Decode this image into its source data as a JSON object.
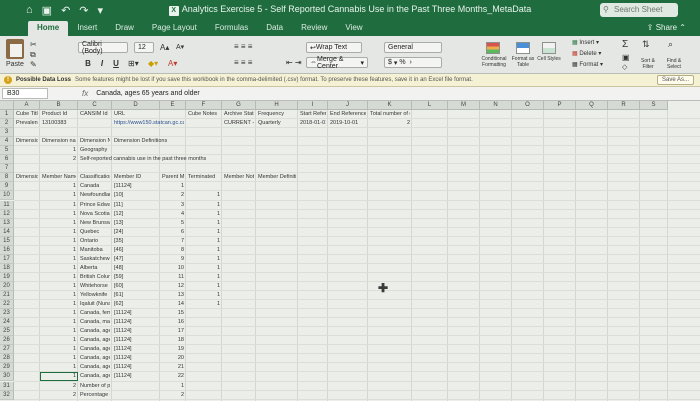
{
  "window": {
    "title": "Analytics Exercise 5 - Self Reported Cannabis Use in the Past Three Months_MetaData",
    "search_placeholder": "Search Sheet"
  },
  "tabs": [
    "Home",
    "Insert",
    "Draw",
    "Page Layout",
    "Formulas",
    "Data",
    "Review",
    "View"
  ],
  "share_label": "Share",
  "ribbon": {
    "paste": "Paste",
    "font_name": "Calibri (Body)",
    "font_size": "12",
    "wrap_text": "Wrap Text",
    "merge_center": "Merge & Center",
    "number_format": "General",
    "currency": "$",
    "percent": "%",
    "conditional_formatting": "Conditional Formatting",
    "format_as_table": "Format as Table",
    "cell_styles": "Cell Styles",
    "insert": "Insert",
    "delete": "Delete",
    "format": "Format",
    "sort_filter": "Sort & Filter",
    "find_select": "Find & Select",
    "bold": "B",
    "italic": "I",
    "underline": "U"
  },
  "infobar": {
    "title": "Possible Data Loss",
    "message": "Some features might be lost if you save this workbook in the comma-delimited (.csv) format. To preserve these features, save it in an Excel file format.",
    "save_as": "Save As..."
  },
  "formula_bar": {
    "name_box": "B30",
    "fx": "fx",
    "content": "Canada, ages 65 years and older"
  },
  "columns": [
    "A",
    "B",
    "C",
    "D",
    "E",
    "F",
    "G",
    "H",
    "I",
    "J",
    "K",
    "L",
    "M",
    "N",
    "O",
    "P",
    "Q",
    "R",
    "S"
  ],
  "rows": [
    "1",
    "2",
    "3",
    "4",
    "5",
    "6",
    "7",
    "8",
    "9",
    "10",
    "11",
    "12",
    "13",
    "14",
    "15",
    "16",
    "17",
    "18",
    "19",
    "20",
    "21",
    "22",
    "23",
    "24",
    "25",
    "26",
    "27",
    "28",
    "29",
    "30",
    "31",
    "32"
  ],
  "cells": {
    "r1": [
      "Cube Title",
      "Product Id",
      "CANSIM Id",
      "URL",
      "",
      "Cube Notes",
      "Archive Status",
      "Frequency",
      "Start Reference",
      "End Reference",
      "Total number of dimensions"
    ],
    "r1_short": [
      "Cube Title",
      "Product Id",
      "CANSIM Id",
      "URL",
      "Cube Notes",
      "Archive Status",
      "Frequency",
      "Start Reference Period",
      "End Reference Period",
      "Total number of dimensions"
    ],
    "r2": [
      "Prevalence o",
      "13100383",
      "https://www150.statcan.gc.ca",
      "CURRENT - a",
      "Quarterly",
      "2018-01-01",
      "2019-10-01",
      "2"
    ],
    "r4": [
      "Dimension ID",
      "Dimension name",
      "Dimension N",
      "Dimension Definitions"
    ],
    "r5": [
      "1",
      "Geography"
    ],
    "r6": [
      "2",
      "Self-reported cannabis use in the past three months"
    ],
    "r8": [
      "Dimension ID",
      "Member Name",
      "Classification",
      "Member ID",
      "Parent Member ID",
      "Terminated",
      "Member Notes",
      "Member Definitions"
    ],
    "members": [
      {
        "dim": "1",
        "name": "Canada",
        "code": "[11124]",
        "id": "1",
        "flag": ""
      },
      {
        "dim": "1",
        "name": "Newfoundland",
        "code": "[10]",
        "id": "2",
        "flag": "1"
      },
      {
        "dim": "1",
        "name": "Prince Edward",
        "code": "[11]",
        "id": "3",
        "flag": "1"
      },
      {
        "dim": "1",
        "name": "Nova Scotia",
        "code": "[12]",
        "id": "4",
        "flag": "1"
      },
      {
        "dim": "1",
        "name": "New Brunswick",
        "code": "[13]",
        "id": "5",
        "flag": "1"
      },
      {
        "dim": "1",
        "name": "Quebec",
        "code": "[24]",
        "id": "6",
        "flag": "1"
      },
      {
        "dim": "1",
        "name": "Ontario",
        "code": "[35]",
        "id": "7",
        "flag": "1"
      },
      {
        "dim": "1",
        "name": "Manitoba",
        "code": "[46]",
        "id": "8",
        "flag": "1"
      },
      {
        "dim": "1",
        "name": "Saskatchewan",
        "code": "[47]",
        "id": "9",
        "flag": "1"
      },
      {
        "dim": "1",
        "name": "Alberta",
        "code": "[48]",
        "id": "10",
        "flag": "1"
      },
      {
        "dim": "1",
        "name": "British Columbia",
        "code": "[59]",
        "id": "11",
        "flag": "1"
      },
      {
        "dim": "1",
        "name": "Whitehorse",
        "code": "[60]",
        "id": "12",
        "flag": "1"
      },
      {
        "dim": "1",
        "name": "Yellowknife",
        "code": "[61]",
        "id": "13",
        "flag": "1"
      },
      {
        "dim": "1",
        "name": "Iqaluit (Nunavut)",
        "code": "[62]",
        "id": "14",
        "flag": "1"
      },
      {
        "dim": "1",
        "name": "Canada, females",
        "code": "[11124]",
        "id": "15",
        "flag": ""
      },
      {
        "dim": "1",
        "name": "Canada, males",
        "code": "[11124]",
        "id": "16",
        "flag": ""
      },
      {
        "dim": "1",
        "name": "Canada, ages",
        "code": "[11124]",
        "id": "17",
        "flag": ""
      },
      {
        "dim": "1",
        "name": "Canada, ages",
        "code": "[11124]",
        "id": "18",
        "flag": ""
      },
      {
        "dim": "1",
        "name": "Canada, ages",
        "code": "[11124]",
        "id": "19",
        "flag": ""
      },
      {
        "dim": "1",
        "name": "Canada, ages",
        "code": "[11124]",
        "id": "20",
        "flag": ""
      },
      {
        "dim": "1",
        "name": "Canada, ages",
        "code": "[11124]",
        "id": "21",
        "flag": ""
      },
      {
        "dim": "1",
        "name": "Canada, ages",
        "code": "[11124]",
        "id": "22",
        "flag": ""
      },
      {
        "dim": "2",
        "name": "Number of people",
        "code": "",
        "id": "1",
        "flag": ""
      },
      {
        "dim": "2",
        "name": "Percentage of people",
        "code": "",
        "id": "2",
        "flag": ""
      }
    ]
  }
}
